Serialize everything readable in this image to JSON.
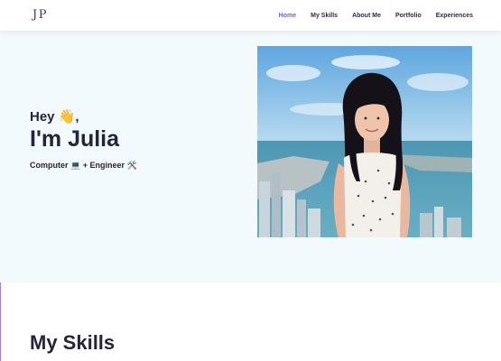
{
  "header": {
    "logo": "JP",
    "nav": [
      {
        "label": "Home",
        "active": true
      },
      {
        "label": "My Skills",
        "active": false
      },
      {
        "label": "About Me",
        "active": false
      },
      {
        "label": "Portfolio",
        "active": false
      },
      {
        "label": "Experiences",
        "active": false
      }
    ]
  },
  "hero": {
    "greeting": "Hey 👋,",
    "name": "I'm Julia",
    "tagline": "Computer 💻 + Engineer 🛠️",
    "photo_icon": "portrait-photo"
  },
  "skills": {
    "title": "My Skills"
  },
  "colors": {
    "accent": "#6c63e0",
    "hero_bg": "#f3fafd",
    "text": "#23263a"
  }
}
